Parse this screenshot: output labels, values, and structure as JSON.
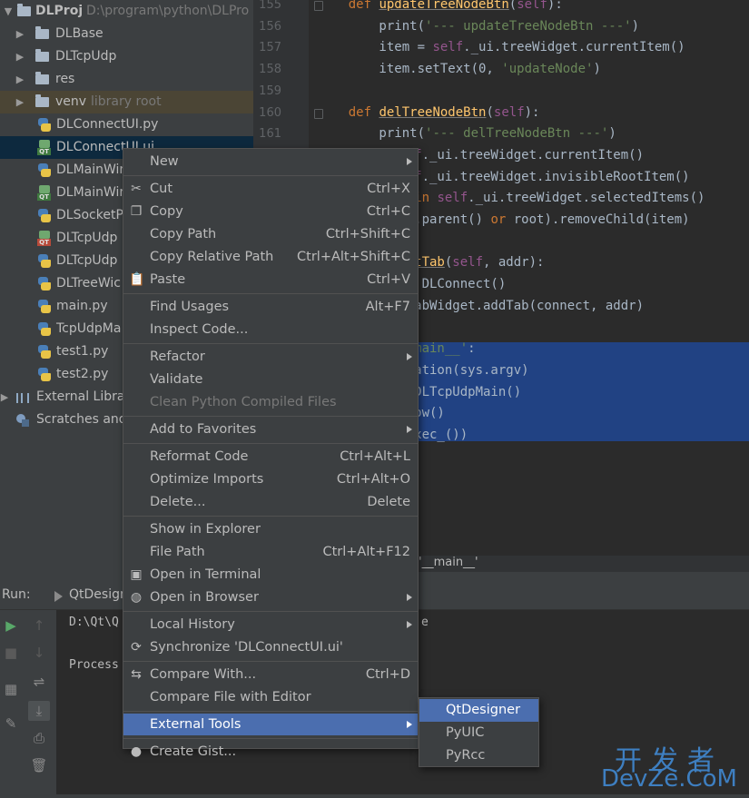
{
  "project_tree": {
    "root": {
      "name": "DLProj",
      "path": "D:\\program\\python\\DLPro"
    },
    "items": [
      {
        "type": "folder",
        "label": "DLBase"
      },
      {
        "type": "folder",
        "label": "DLTcpUdp"
      },
      {
        "type": "folder",
        "label": "res"
      },
      {
        "type": "folder",
        "label": "venv",
        "hint": "library root"
      },
      {
        "type": "py",
        "label": "DLConnectUI.py"
      },
      {
        "type": "ui",
        "label": "DLConnectUI.ui"
      },
      {
        "type": "py",
        "label": "DLMainWir"
      },
      {
        "type": "ui",
        "label": "DLMainWir"
      },
      {
        "type": "py",
        "label": "DLSocketP"
      },
      {
        "type": "ui2",
        "label": "DLTcpUdp"
      },
      {
        "type": "py",
        "label": "DLTcpUdp"
      },
      {
        "type": "py",
        "label": "DLTreeWic"
      },
      {
        "type": "py",
        "label": "main.py"
      },
      {
        "type": "py",
        "label": "TcpUdpMa"
      },
      {
        "type": "py",
        "label": "test1.py"
      },
      {
        "type": "py",
        "label": "test2.py"
      },
      {
        "type": "libs",
        "label": "External Librar"
      },
      {
        "type": "scratch",
        "label": "Scratches and"
      }
    ]
  },
  "editor": {
    "lines": [
      {
        "num": "155",
        "text": "    def updateTreeNodeBtn(self):"
      },
      {
        "num": "156",
        "text": "        print('--- updateTreeNodeBtn ---')"
      },
      {
        "num": "157",
        "text": "        item = self._ui.treeWidget.currentItem()"
      },
      {
        "num": "158",
        "text": "        item.setText(0, 'updateNode')"
      },
      {
        "num": "159",
        "text": ""
      },
      {
        "num": "160",
        "text": "    def delTreeNodeBtn(self):"
      },
      {
        "num": "161",
        "text": "        print('--- delTreeNodeBtn ---')"
      },
      {
        "num": "",
        "text": "= self._ui.treeWidget.currentItem()"
      },
      {
        "num": "",
        "text": "= self._ui.treeWidget.invisibleRootItem()"
      },
      {
        "num": "",
        "text": "item in self._ui.treeWidget.selectedItems()"
      },
      {
        "num": "",
        "text": "(item.parent() or root).removeChild(item)"
      },
      {
        "num": "",
        "text": ""
      },
      {
        "num": "",
        "text": "onnectTab(self, addr):"
      },
      {
        "num": "",
        "text": "ect = DLConnect()"
      },
      {
        "num": "",
        "text": "_ui.tabWidget.addTab(connect, addr)"
      },
      {
        "num": "",
        "text": ""
      },
      {
        "num": "",
        "text": "= '__main__':"
      },
      {
        "num": "",
        "text": "pplication(sys.argv)"
      },
      {
        "num": "",
        "text": "ow = DLTcpUdpMain()"
      },
      {
        "num": "",
        "text": "ow.show()"
      },
      {
        "num": "",
        "text": "app.exec_())"
      }
    ],
    "breadcrumb": "'__main__'"
  },
  "run_panel": {
    "title": "Run:",
    "tab_label": "QtDesign",
    "console_lines": [
      "D:\\Qt\\Q",
      "Process"
    ],
    "console_suffix": "e"
  },
  "context_menu": {
    "items": [
      {
        "label": "New",
        "shortcut": "",
        "submenu": true,
        "icon": ""
      },
      {
        "sep": true
      },
      {
        "label": "Cut",
        "shortcut": "Ctrl+X",
        "icon": "scissors-icon"
      },
      {
        "label": "Copy",
        "shortcut": "Ctrl+C",
        "icon": "copy-icon"
      },
      {
        "label": "Copy Path",
        "shortcut": "Ctrl+Shift+C"
      },
      {
        "label": "Copy Relative Path",
        "shortcut": "Ctrl+Alt+Shift+C"
      },
      {
        "label": "Paste",
        "shortcut": "Ctrl+V",
        "icon": "paste-icon"
      },
      {
        "sep": true
      },
      {
        "label": "Find Usages",
        "shortcut": "Alt+F7"
      },
      {
        "label": "Inspect Code...",
        "shortcut": ""
      },
      {
        "sep": true
      },
      {
        "label": "Refactor",
        "submenu": true
      },
      {
        "label": "Validate",
        "shortcut": ""
      },
      {
        "label": "Clean Python Compiled Files",
        "disabled": true
      },
      {
        "sep": true
      },
      {
        "label": "Add to Favorites",
        "submenu": true
      },
      {
        "sep": true
      },
      {
        "label": "Reformat Code",
        "shortcut": "Ctrl+Alt+L"
      },
      {
        "label": "Optimize Imports",
        "shortcut": "Ctrl+Alt+O"
      },
      {
        "label": "Delete...",
        "shortcut": "Delete"
      },
      {
        "sep": true
      },
      {
        "label": "Show in Explorer",
        "shortcut": ""
      },
      {
        "label": "File Path",
        "shortcut": "Ctrl+Alt+F12"
      },
      {
        "label": "Open in Terminal",
        "icon": "terminal-icon"
      },
      {
        "label": "Open in Browser",
        "submenu": true,
        "icon": "globe-icon"
      },
      {
        "sep": true
      },
      {
        "label": "Local History",
        "submenu": true
      },
      {
        "label": "Synchronize 'DLConnectUI.ui'",
        "icon": "sync-icon"
      },
      {
        "sep": true
      },
      {
        "label": "Compare With...",
        "shortcut": "Ctrl+D",
        "icon": "compare-icon"
      },
      {
        "label": "Compare File with Editor",
        "shortcut": ""
      },
      {
        "sep": true
      },
      {
        "label": "External Tools",
        "submenu": true,
        "active": true
      },
      {
        "sep": true
      },
      {
        "label": "Create Gist...",
        "icon": "github-icon"
      }
    ]
  },
  "submenu": {
    "items": [
      "QtDesigner",
      "PyUIC",
      "PyRcc"
    ],
    "active_index": 0
  },
  "watermark": {
    "top": "开发者",
    "bottom": "DevZe.CoM"
  },
  "colors": {
    "menu_bg": "#3c3f41",
    "menu_active": "#4b6eaf",
    "selection": "#214283",
    "keyword": "#cc7832",
    "string": "#6a8759",
    "function": "#ffc66d",
    "self": "#94558d"
  }
}
